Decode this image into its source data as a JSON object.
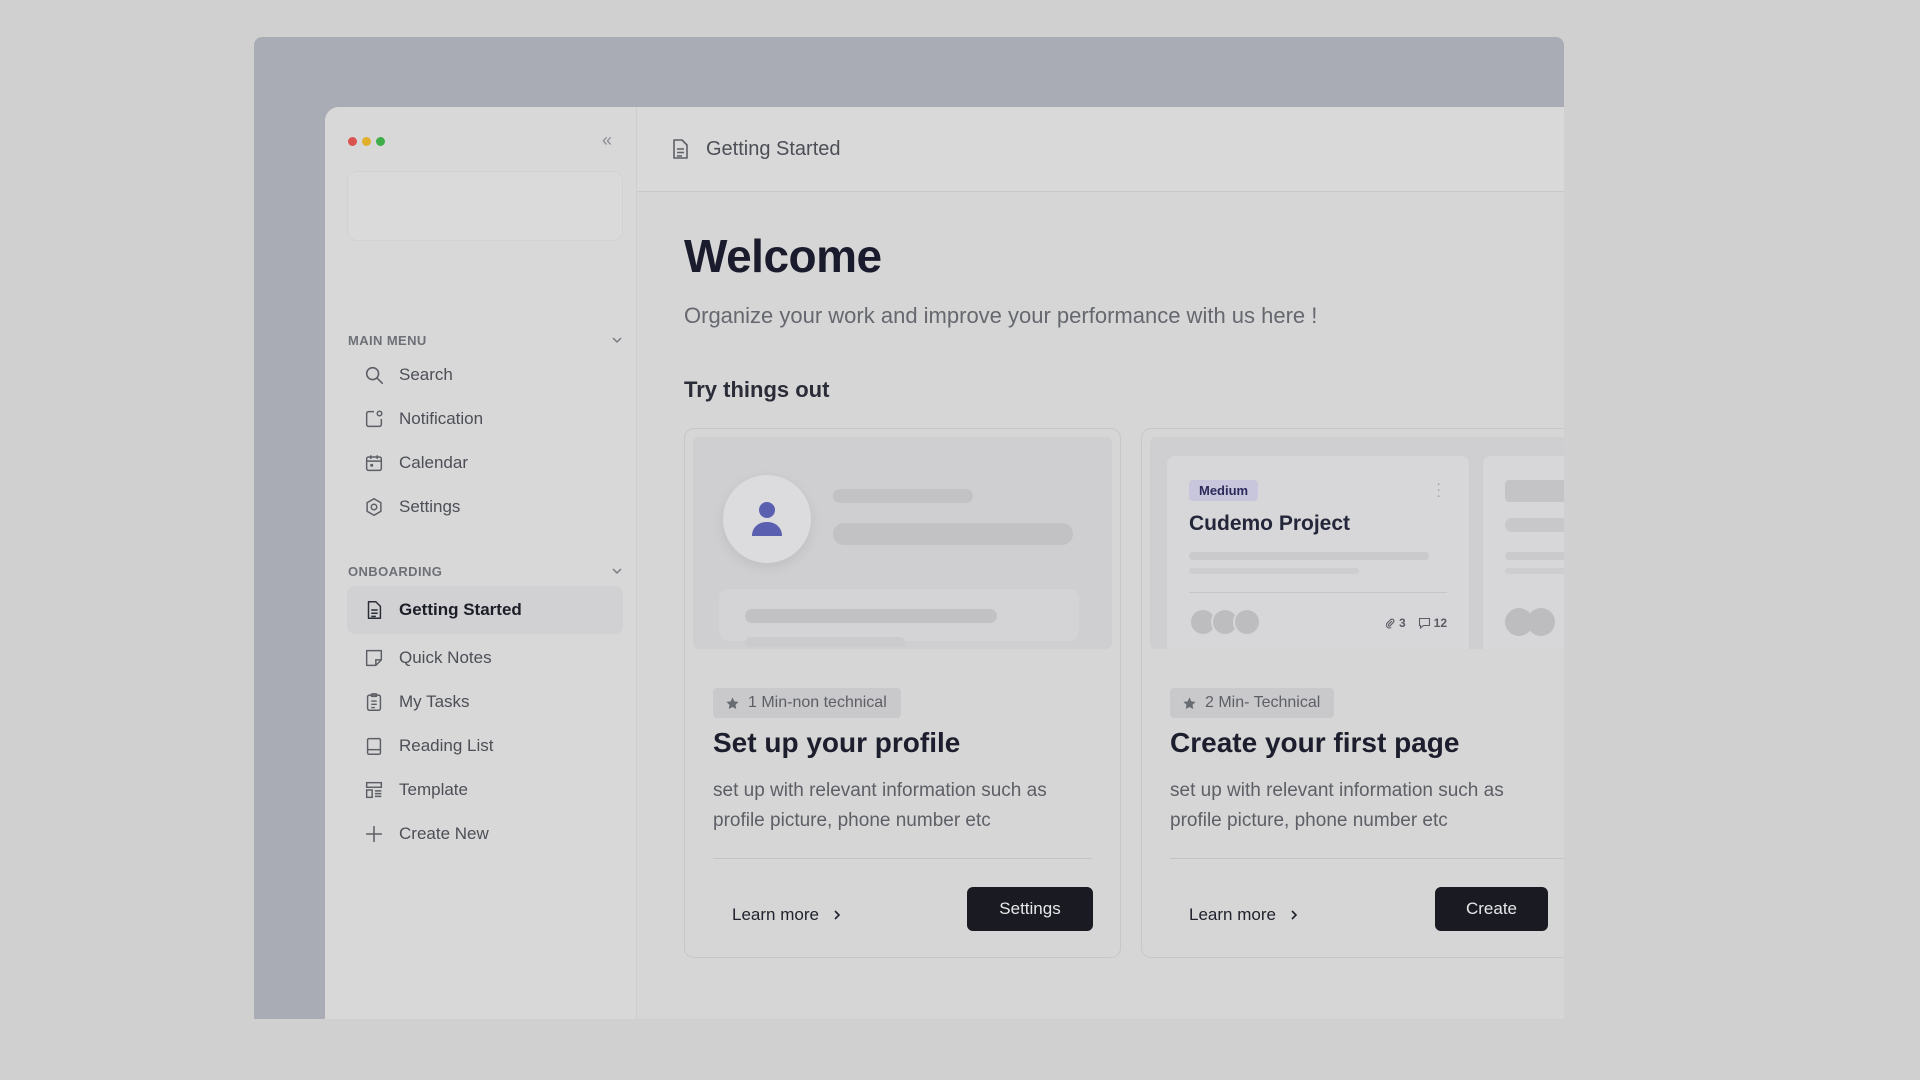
{
  "sidebar": {
    "traffic_colors": [
      "#d9534f",
      "#e0b02c",
      "#3fae49"
    ],
    "main_menu": {
      "label": "MAIN MENU",
      "items": [
        {
          "label": "Search",
          "icon": "search-icon"
        },
        {
          "label": "Notification",
          "icon": "notification-icon"
        },
        {
          "label": "Calendar",
          "icon": "calendar-icon"
        },
        {
          "label": "Settings",
          "icon": "settings-icon"
        }
      ]
    },
    "onboarding": {
      "label": "ONBOARDING",
      "items": [
        {
          "label": "Getting Started",
          "icon": "document-icon",
          "active": true
        },
        {
          "label": "Quick Notes",
          "icon": "note-icon"
        },
        {
          "label": "My Tasks",
          "icon": "clipboard-icon"
        },
        {
          "label": "Reading List",
          "icon": "book-icon"
        },
        {
          "label": "Template",
          "icon": "template-icon"
        },
        {
          "label": "Create New",
          "icon": "plus-icon"
        }
      ]
    }
  },
  "header": {
    "title": "Getting Started"
  },
  "main": {
    "welcome": "Welcome",
    "subtitle": "Organize your work and improve your performance with us here !",
    "section_title": "Try things out",
    "cards": [
      {
        "badge": "1 Min-non technical",
        "title": "Set up your profile",
        "description": "set up with relevant information such as profile picture, phone number etc",
        "learn_more": "Learn more",
        "action": "Settings"
      },
      {
        "badge": "2 Min- Technical",
        "title": "Create your first page",
        "description": "set up with relevant information such as profile picture, phone number etc",
        "learn_more": "Learn more",
        "action": "Create",
        "preview": {
          "priority": "Medium",
          "project": "Cudemo Project",
          "attachments": "3",
          "comments": "12"
        }
      }
    ]
  }
}
